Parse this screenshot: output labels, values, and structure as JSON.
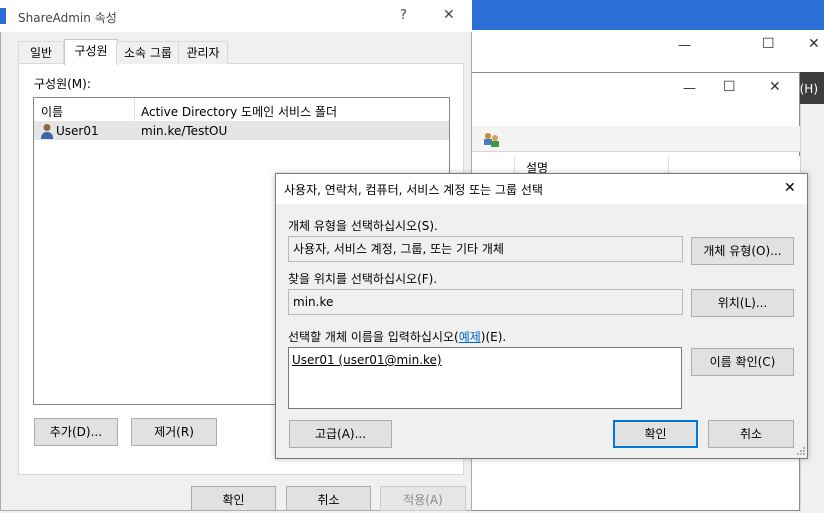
{
  "share_dialog": {
    "title": "ShareAdmin 속성",
    "help_glyph": "?",
    "close_glyph": "✕",
    "tabs": [
      {
        "label": "일반"
      },
      {
        "label": "구성원"
      },
      {
        "label": "소속 그룹"
      },
      {
        "label": "관리자"
      }
    ],
    "members_label": "구성원(M):",
    "columns": [
      "이름",
      "Active Directory 도메인 서비스 폴더"
    ],
    "rows": [
      {
        "name": "User01",
        "folder": "min.ke/TestOU"
      }
    ],
    "add_button": "추가(D)...",
    "remove_button": "제거(R)",
    "ok_button": "확인",
    "cancel_button": "취소",
    "apply_button": "적용(A)"
  },
  "select_dialog": {
    "title": "사용자, 연락처, 컴퓨터, 서비스 계정 또는 그룹 선택",
    "close_glyph": "✕",
    "object_type_label": "개체 유형을 선택하십시오(S).",
    "object_type_value": "사용자, 서비스 계정, 그룹, 또는 기타 개체",
    "object_types_button": "개체 유형(O)...",
    "location_label": "찾을 위치를 선택하십시오(F).",
    "location_value": "min.ke",
    "location_button": "위치(L)...",
    "names_label_prefix": "선택할 개체 이름을 입력하십시오(",
    "names_label_link": "예제",
    "names_label_suffix": ")(E).",
    "names_value": "User01 (user01@min.ke)",
    "check_names_button": "이름 확인(C)",
    "advanced_button": "고급(A)...",
    "ok_button": "확인",
    "cancel_button": "취소"
  },
  "background": {
    "minimize_glyph": "—",
    "maximize_glyph": "☐",
    "close_glyph": "✕",
    "inner_minimize_glyph": "—",
    "inner_maximize_glyph": "☐",
    "inner_close_glyph": "✕",
    "menu_hint": "(H)",
    "column_description": "설명"
  },
  "colors": {
    "accent": "#0078d7",
    "title_blue": "#2b6fd6",
    "link": "#0066cc"
  }
}
